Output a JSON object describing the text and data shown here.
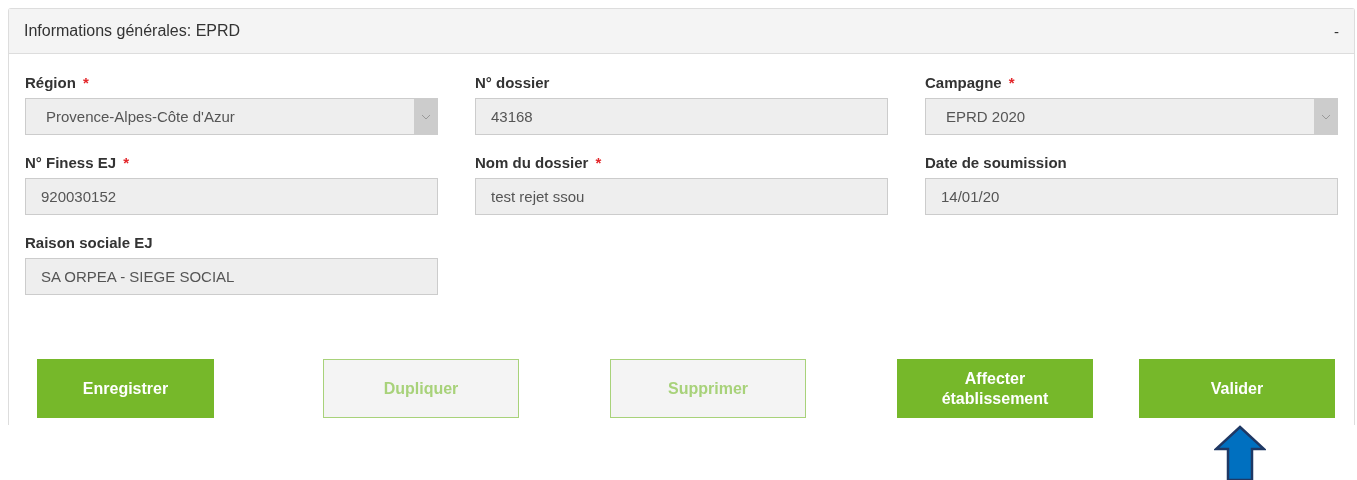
{
  "panel": {
    "title": "Informations générales: EPRD",
    "collapse_symbol": "-"
  },
  "fields": [
    {
      "label": "Région",
      "required": true,
      "kind": "select",
      "value": "Provence-Alpes-Côte d'Azur"
    },
    {
      "label": "N° dossier",
      "required": false,
      "kind": "text",
      "value": "43168"
    },
    {
      "label": "Campagne",
      "required": true,
      "kind": "select",
      "value": "EPRD 2020"
    },
    {
      "label": "N° Finess EJ",
      "required": true,
      "kind": "text",
      "value": "920030152"
    },
    {
      "label": "Nom du dossier",
      "required": true,
      "kind": "text",
      "value": "test rejet ssou"
    },
    {
      "label": "Date de soumission",
      "required": false,
      "kind": "text",
      "value": "14/01/20"
    },
    {
      "label": "Raison sociale EJ",
      "required": false,
      "kind": "text",
      "value": "SA ORPEA - SIEGE SOCIAL"
    }
  ],
  "required_mark": "*",
  "buttons": [
    {
      "label": "Enregistrer",
      "disabled": false
    },
    {
      "label": "Dupliquer",
      "disabled": true
    },
    {
      "label": "Supprimer",
      "disabled": true
    },
    {
      "label": "Affecter établissement",
      "disabled": false
    },
    {
      "label": "Valider",
      "disabled": false
    }
  ]
}
